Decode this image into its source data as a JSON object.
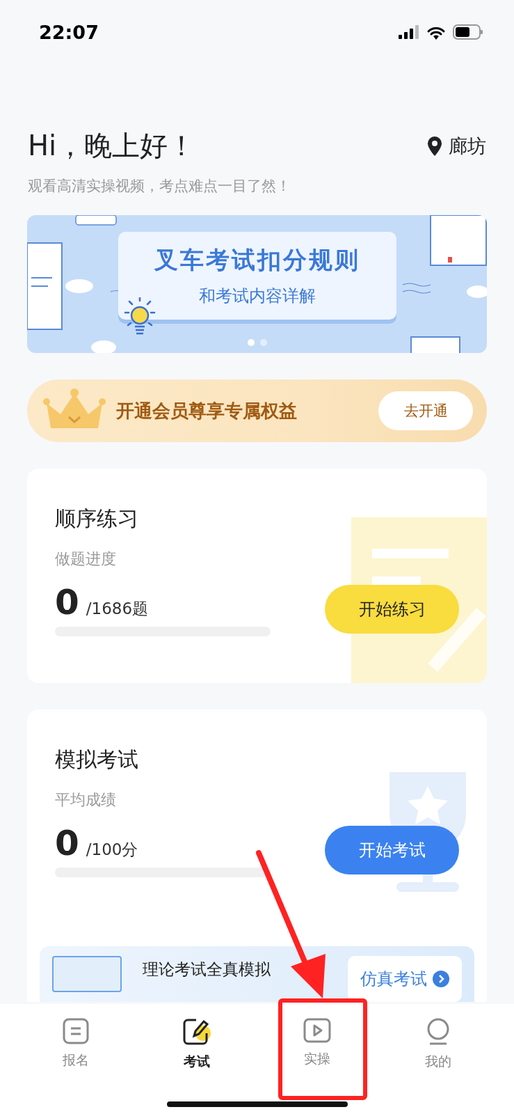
{
  "status_bar": {
    "time": "22:07"
  },
  "header": {
    "greeting": "Hi，晚上好！",
    "location": "廊坊",
    "subtitle": "观看高清实操视频，考点难点一目了然！"
  },
  "banner": {
    "title": "叉车考试扣分规则",
    "subtitle": "和考试内容详解",
    "dots": [
      {
        "selected": true
      },
      {
        "selected": false
      }
    ]
  },
  "membership": {
    "text": "开通会员尊享专属权益",
    "button": "去开通"
  },
  "cards": [
    {
      "kind": "practice",
      "title": "顺序练习",
      "label": "做题进度",
      "value": "0",
      "total": "/1686题",
      "level": 0,
      "button": "开始练习"
    },
    {
      "kind": "exam",
      "title": "模拟考试",
      "label": "平均成绩",
      "value": "0",
      "total": "/100分",
      "level": 0,
      "button": "开始考试",
      "promo": {
        "title": "理论考试全真模拟",
        "button": "仿真考试"
      }
    }
  ],
  "tab_bar": [
    {
      "kind": "signup",
      "label": "报名",
      "selected": false
    },
    {
      "kind": "exam",
      "label": "考试",
      "selected": true
    },
    {
      "kind": "practice",
      "label": "实操",
      "selected": false
    },
    {
      "kind": "profile",
      "label": "我的",
      "selected": false
    }
  ]
}
